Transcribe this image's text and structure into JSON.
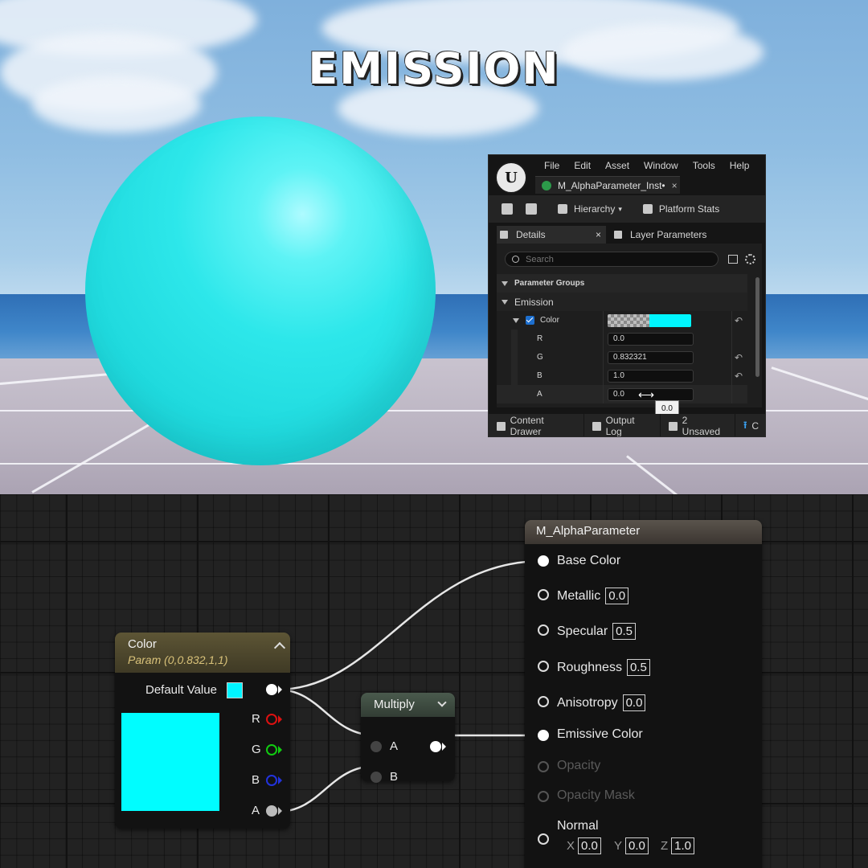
{
  "title": "EMISSION",
  "editor": {
    "menu": [
      "File",
      "Edit",
      "Asset",
      "Window",
      "Tools",
      "Help"
    ],
    "asset_tab": "M_AlphaParameter_Inst•",
    "toolbar": {
      "hierarchy": "Hierarchy",
      "platform_stats": "Platform Stats"
    },
    "tabs": {
      "details": "Details",
      "layer_parameters": "Layer Parameters"
    },
    "search_placeholder": "Search",
    "groups": {
      "parameter_groups": "Parameter Groups",
      "emission": "Emission"
    },
    "params": {
      "color_label": "Color",
      "r_label": "R",
      "r_value": "0.0",
      "g_label": "G",
      "g_value": "0.832321",
      "b_label": "B",
      "b_value": "1.0",
      "a_label": "A",
      "a_value": "0.0"
    },
    "tooltip": "0.0",
    "status": {
      "content_drawer": "Content Drawer",
      "output_log": "Output Log",
      "unsaved": "2 Unsaved",
      "cut": "C"
    },
    "colors": {
      "swatch": "#00f6ff",
      "accent": "#1d6fcf"
    }
  },
  "graph": {
    "color_node": {
      "title": "Color",
      "subtitle": "Param (0,0.832,1,1)",
      "default_value": "Default Value",
      "channels": [
        "R",
        "G",
        "B",
        "A"
      ],
      "swatch_color": "#00fdff"
    },
    "multiply_node": {
      "title": "Multiply",
      "in_a": "A",
      "in_b": "B"
    },
    "material_node": {
      "title": "M_AlphaParameter",
      "base_color": "Base Color",
      "metallic": "Metallic",
      "metallic_value": "0.0",
      "specular": "Specular",
      "specular_value": "0.5",
      "roughness": "Roughness",
      "roughness_value": "0.5",
      "anisotropy": "Anisotropy",
      "anisotropy_value": "0.0",
      "emissive": "Emissive Color",
      "opacity": "Opacity",
      "opacity_mask": "Opacity Mask",
      "normal": "Normal",
      "x_label": "X",
      "x_value": "0.0",
      "y_label": "Y",
      "y_value": "0.0",
      "z_label": "Z",
      "z_value": "1.0"
    }
  }
}
